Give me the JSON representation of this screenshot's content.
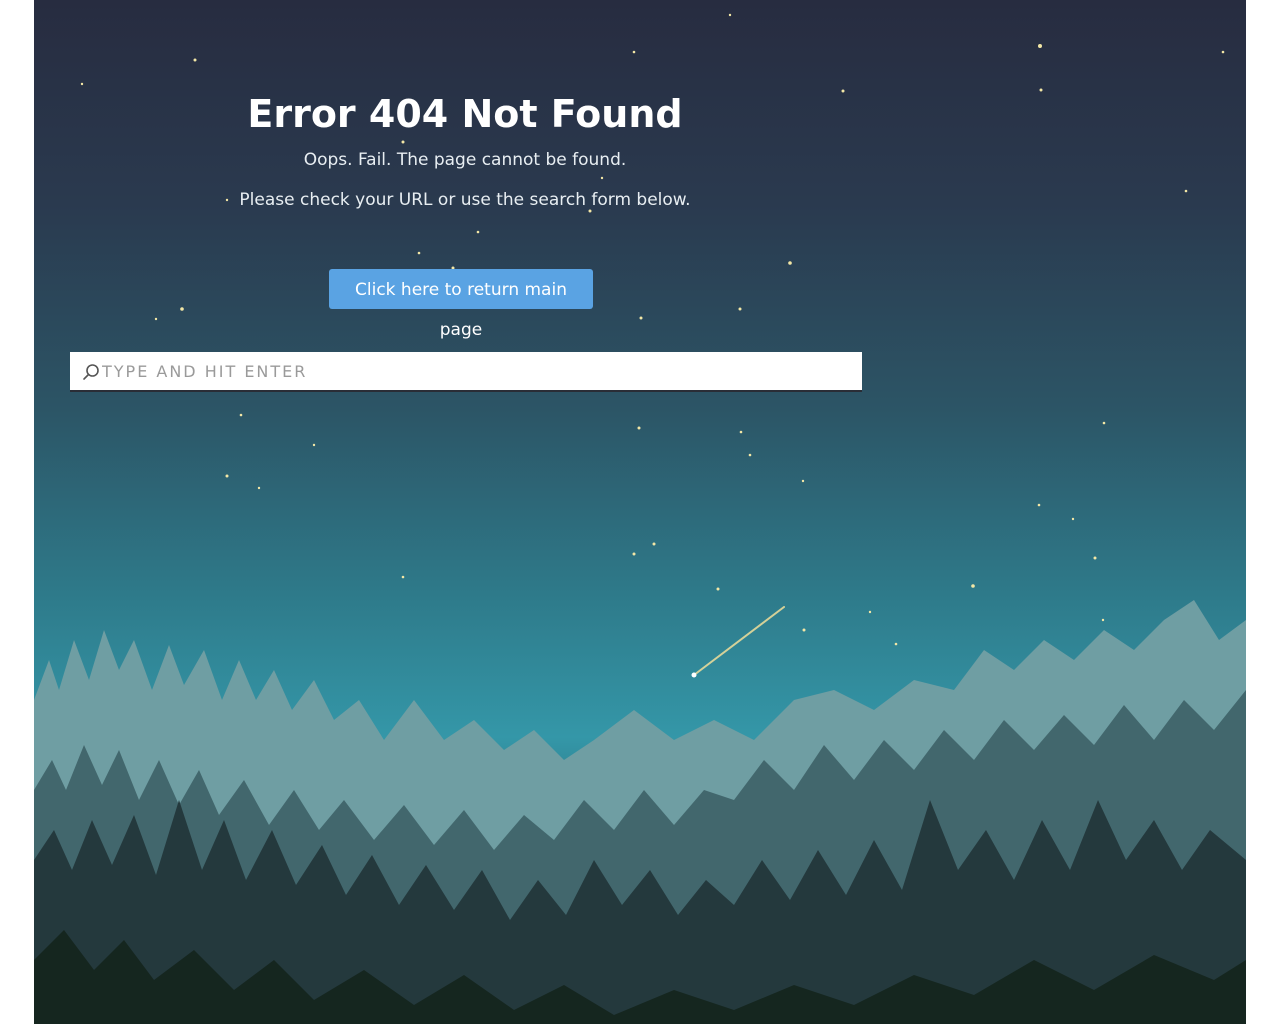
{
  "page": {
    "title": "Error 404 Not Found",
    "line1": "Oops. Fail. The page cannot be found.",
    "line2": "Please check your URL or use the search form below.",
    "home_button_label": "Click here to return main page"
  },
  "search": {
    "placeholder": "TYPE AND HIT ENTER",
    "value": "",
    "icon": "search-icon"
  },
  "colors": {
    "button": "#5aa3e3",
    "sky_top": "#272c40",
    "sky_mid": "#3497a8",
    "forest_dark": "#1f3b3f"
  }
}
